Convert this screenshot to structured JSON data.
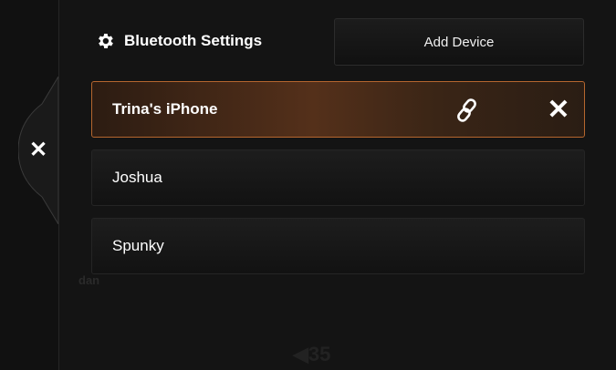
{
  "header": {
    "title": "Bluetooth Settings",
    "gear_icon": "gear-icon",
    "add_device_label": "Add Device"
  },
  "side_panel": {
    "close_glyph": "✕"
  },
  "devices": [
    {
      "name": "Trina's iPhone",
      "connected": true
    },
    {
      "name": "Joshua",
      "connected": false
    },
    {
      "name": "Spunky",
      "connected": false
    }
  ],
  "device_actions": {
    "link_icon": "link-icon",
    "remove_glyph": "✕"
  },
  "background": {
    "ghost_label": "dan",
    "volume": "◀35"
  },
  "colors": {
    "accent": "#b5662e",
    "background": "#141414"
  }
}
